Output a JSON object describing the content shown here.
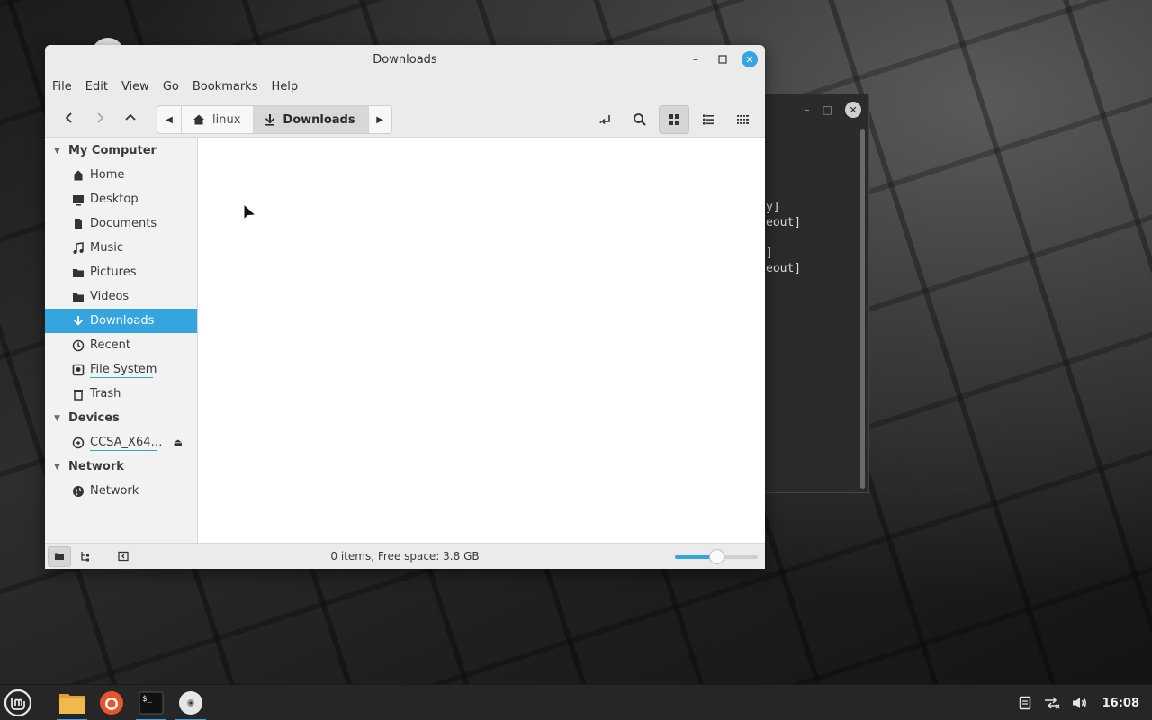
{
  "window": {
    "title": "Downloads"
  },
  "menubar": {
    "items": [
      "File",
      "Edit",
      "View",
      "Go",
      "Bookmarks",
      "Help"
    ]
  },
  "pathbar": {
    "crumbs": [
      {
        "label": "linux",
        "icon": "home-icon"
      },
      {
        "label": "Downloads",
        "icon": "download-icon"
      }
    ]
  },
  "sidebar": {
    "sections": [
      {
        "title": "My Computer",
        "items": [
          {
            "label": "Home",
            "icon": "home-icon"
          },
          {
            "label": "Desktop",
            "icon": "desktop-icon"
          },
          {
            "label": "Documents",
            "icon": "document-icon"
          },
          {
            "label": "Music",
            "icon": "music-icon"
          },
          {
            "label": "Pictures",
            "icon": "folder-icon"
          },
          {
            "label": "Videos",
            "icon": "folder-icon"
          },
          {
            "label": "Downloads",
            "icon": "download-icon",
            "selected": true
          },
          {
            "label": "Recent",
            "icon": "clock-icon"
          },
          {
            "label": "File System",
            "icon": "drive-icon"
          },
          {
            "label": "Trash",
            "icon": "trash-icon"
          }
        ]
      },
      {
        "title": "Devices",
        "items": [
          {
            "label": "CCSA_X64…",
            "icon": "disc-icon",
            "eject": true
          }
        ]
      },
      {
        "title": "Network",
        "items": [
          {
            "label": "Network",
            "icon": "globe-icon"
          }
        ]
      }
    ]
  },
  "status": {
    "text": "0 items, Free space: 3.8 GB",
    "zoom_level": 0.5
  },
  "terminal": {
    "lines": [
      "y]",
      "eout]",
      "]",
      "eout]"
    ]
  },
  "taskbar": {
    "apps": [
      "mint-menu-icon",
      "file-manager-icon",
      "firefox-icon",
      "terminal-icon",
      "disc-icon"
    ],
    "clock": "16:08"
  },
  "colors": {
    "accent": "#35a5e0",
    "window_bg": "#f2f2f2",
    "taskbar_bg": "#262626"
  }
}
